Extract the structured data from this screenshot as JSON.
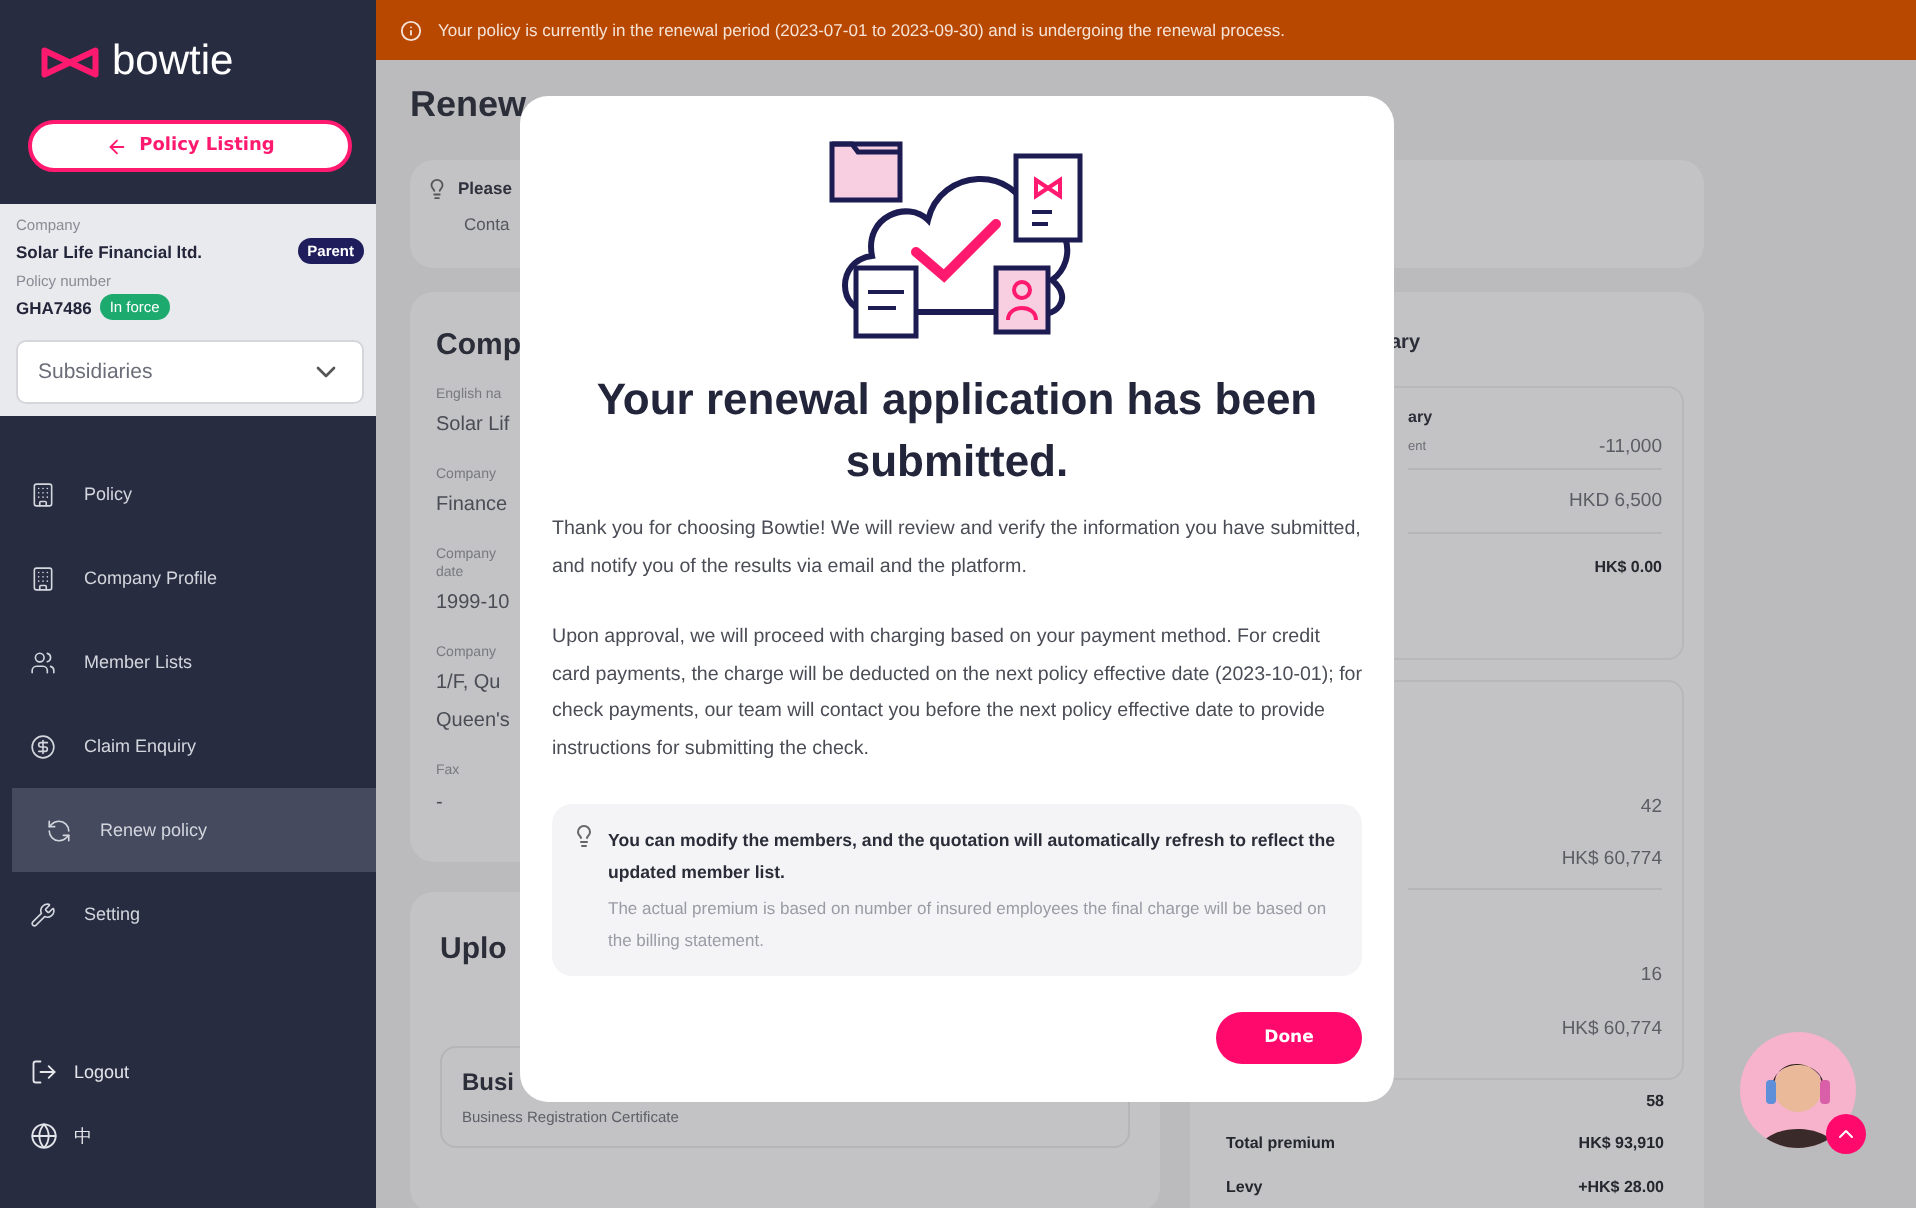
{
  "sidebar": {
    "logo": "bowtie",
    "back_button": "Policy Listing",
    "policy_info": {
      "company_label": "Company",
      "company": "Solar Life Financial ltd.",
      "company_badge": "Parent",
      "policy_label": "Policy number",
      "policy_number": "GHA7486",
      "status": "In force"
    },
    "subsidiaries_select": {
      "value": "Subsidiaries"
    },
    "nav": [
      {
        "label": "Policy",
        "selected": false
      },
      {
        "label": "Company Profile",
        "selected": false
      },
      {
        "label": "Member Lists",
        "selected": false
      },
      {
        "label": "Claim Enquiry",
        "selected": false
      },
      {
        "label": "Renew policy",
        "selected": true
      },
      {
        "label": "Setting",
        "selected": false
      }
    ],
    "footer": [
      {
        "label": "Logout"
      },
      {
        "label": "中"
      }
    ]
  },
  "banner": {
    "text": "Your policy is currently in the renewal period (2023-07-01 to 2023-09-30) and is undergoing the renewal process."
  },
  "page": {
    "title": "Renew",
    "tip": {
      "title": "Please",
      "text": "Conta"
    },
    "company_card": {
      "heading": "Comp",
      "fields": [
        {
          "label": [
            "English na"
          ],
          "values": [
            "Solar Lif"
          ]
        },
        {
          "label": [
            "Company"
          ],
          "values": [
            "Finance"
          ]
        },
        {
          "label": [
            "Company",
            "date"
          ],
          "values": [
            "1999-10"
          ]
        },
        {
          "label": [
            "Company"
          ],
          "values": [
            "1/F, Qu",
            "Queen's"
          ]
        },
        {
          "label": [
            "Fax"
          ],
          "values": [
            "-"
          ]
        }
      ]
    },
    "upload_card": {
      "heading": "Uplo",
      "document": {
        "title": "Busi",
        "subtitle": "Business Registration Certificate"
      }
    },
    "summary_card": {
      "heading": "ary",
      "box_1": {
        "heading": "ary",
        "rows": [
          {
            "label": "ent",
            "value": "-11,000",
            "emphasis": false
          },
          {
            "value": "HKD 6,500",
            "emphasis": false
          },
          {
            "value": "HK$ 0.00",
            "emphasis": true
          }
        ]
      },
      "box_2": {
        "rows": [
          {
            "value": "42",
            "emphasis": false
          },
          {
            "value": "HK$ 60,774",
            "emphasis": false
          },
          {
            "value": "16",
            "emphasis": false
          },
          {
            "value": "HK$ 60,774",
            "emphasis": false
          }
        ]
      },
      "totals": [
        {
          "value": "58",
          "emphasis": true
        },
        {
          "label": "Total premium",
          "value": "HK$ 93,910",
          "emphasis": true
        },
        {
          "label": "Levy",
          "value": "+HK$ 28.00",
          "emphasis": true
        }
      ]
    }
  },
  "modal": {
    "title": "Your renewal application has been submitted.",
    "paragraphs": [
      "Thank you for choosing Bowtie! We will review and verify the information you have submitted, and notify you of the results via email and the platform.",
      "Upon approval, we will proceed with charging based on your payment method. For credit card payments, the charge will be deducted on the next policy effective date (2023-10-01); for check payments, our team will contact you before the next policy effective date to provide instructions for submitting the check."
    ],
    "tip": {
      "title": "You can modify the members, and the quotation will automatically refresh to reflect the updated member list.",
      "text": "The actual premium is based on number of insured employees the final charge will be based on the billing statement."
    },
    "done_button": "Done"
  }
}
